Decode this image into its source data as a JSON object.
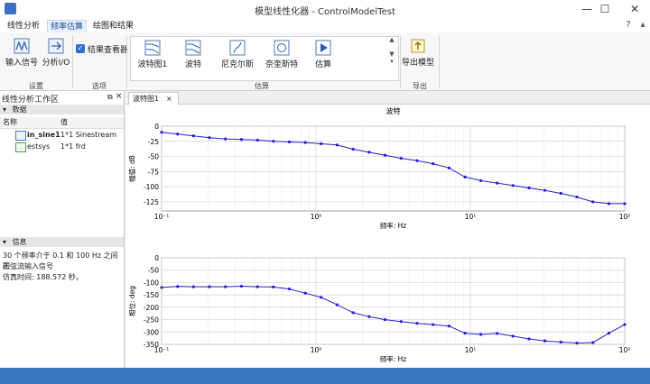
{
  "window": {
    "title": "模型线性化器 - ControlModelTest",
    "minimize": "—",
    "maximize": "☐",
    "close": "✕"
  },
  "tabs": [
    {
      "label": "线性分析"
    },
    {
      "label": "频率估算"
    },
    {
      "label": "绘图和结果"
    }
  ],
  "ribbon": {
    "setup": {
      "input_signal": "输入信号",
      "analysis_io": "分析I/O",
      "group": "设置"
    },
    "options": {
      "result_viewer": "结果查看器",
      "group": "选项"
    },
    "estimate": {
      "items": [
        {
          "label": "波特图1"
        },
        {
          "label": "波特"
        },
        {
          "label": "尼克尔斯"
        },
        {
          "label": "奈奎斯特"
        },
        {
          "label": "估算"
        }
      ],
      "group": "估算"
    },
    "export": {
      "export_model": "导出模型",
      "group": "导出"
    }
  },
  "workspace": {
    "title": "线性分析工作区",
    "data_section": "数据",
    "col_name": "名称",
    "col_value": "值",
    "rows": [
      {
        "name": "in_sine1",
        "value": "1*1 Sinestream"
      },
      {
        "name": "estsys",
        "value": "1*1 frd"
      }
    ],
    "info_section": "信息",
    "info_lines": [
      "30 个频率介于 0.1 和 100 Hz 之间的",
      "正弦流输入信号",
      "仿真时间:   188.572 秒。"
    ]
  },
  "doc_tab": {
    "label": "波特图1",
    "close": "×"
  },
  "chart_data": {
    "type": "line",
    "title": "波特",
    "xscale": "log",
    "xlabel": "频率:  Hz",
    "xlim": [
      0.1,
      100
    ],
    "xticks": [
      "10⁻¹",
      "10⁰",
      "10¹",
      "10²"
    ],
    "grid": true,
    "x": [
      0.1,
      0.127,
      0.161,
      0.204,
      0.259,
      0.329,
      0.418,
      0.53,
      0.672,
      0.853,
      1.08,
      1.37,
      1.74,
      2.21,
      2.8,
      3.56,
      4.52,
      5.74,
      7.28,
      9.24,
      11.7,
      14.9,
      18.9,
      24.0,
      30.4,
      38.6,
      49.0,
      62.2,
      78.9,
      100
    ],
    "magnitude": {
      "ylabel": "幅值:  dB",
      "ylim": [
        -140,
        0
      ],
      "yticks": [
        0,
        -25,
        -50,
        -75,
        -100,
        -125
      ],
      "values": [
        -10,
        -13,
        -16,
        -19,
        -21,
        -22,
        -23,
        -25,
        -26,
        -27,
        -29,
        -31,
        -38,
        -43,
        -48,
        -53,
        -57,
        -62,
        -69,
        -84,
        -90,
        -94,
        -98,
        -102,
        -106,
        -111,
        -117,
        -125,
        -128,
        -128
      ]
    },
    "phase": {
      "ylabel": "相位:  deg",
      "ylim": [
        -350,
        0
      ],
      "yticks": [
        0,
        -50,
        -100,
        -150,
        -200,
        -250,
        -300,
        -350
      ],
      "values": [
        -120,
        -116,
        -117,
        -117,
        -117,
        -115,
        -117,
        -118,
        -126,
        -143,
        -160,
        -190,
        -222,
        -238,
        -250,
        -258,
        -265,
        -270,
        -276,
        -305,
        -310,
        -306,
        -317,
        -328,
        -336,
        -341,
        -345,
        -343,
        -305,
        -270
      ]
    },
    "color": "#2222cc"
  }
}
